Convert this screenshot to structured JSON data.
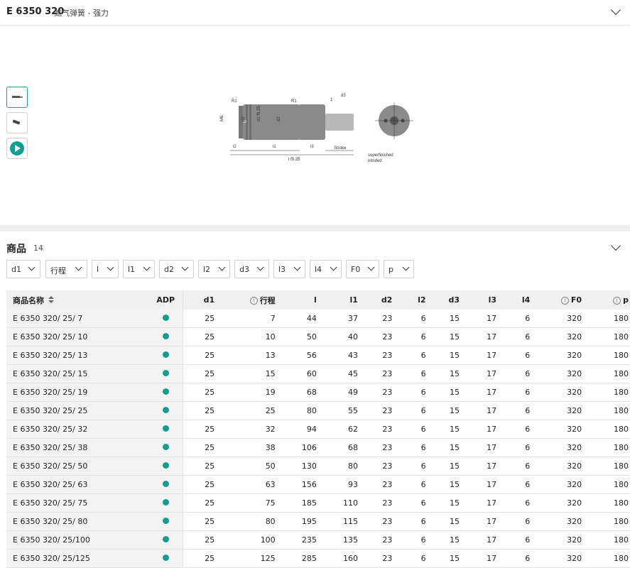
{
  "header": {
    "code": "E 6350 320",
    "subtitle": "氮气弹簧 - 强力"
  },
  "drawing": {
    "labels": [
      "M6",
      "d2",
      "d1 f9.25",
      "d2",
      "R1",
      "R1",
      "1",
      "d3",
      "l2",
      "l1",
      "l3",
      "Stroke",
      "l f9.25",
      "superfinished",
      "nitrided",
      "Φ"
    ]
  },
  "thumbnails": [
    "drawing-thumb",
    "product-photo-thumb",
    "play-video-thumb"
  ],
  "products": {
    "title": "商品",
    "count": "14",
    "filters": [
      "d1",
      "行程",
      "l",
      "l1",
      "d2",
      "l2",
      "d3",
      "l3",
      "l4",
      "F0",
      "p"
    ],
    "columns": [
      "商品名称",
      "ADP",
      "d1",
      "行程",
      "l",
      "l1",
      "d2",
      "l2",
      "d3",
      "l3",
      "l4",
      "F0",
      "p"
    ],
    "rows": [
      [
        "E 6350 320/ 25/ 7",
        "25",
        "7",
        "44",
        "37",
        "23",
        "6",
        "15",
        "17",
        "6",
        "320",
        "180"
      ],
      [
        "E 6350 320/ 25/ 10",
        "25",
        "10",
        "50",
        "40",
        "23",
        "6",
        "15",
        "17",
        "6",
        "320",
        "180"
      ],
      [
        "E 6350 320/ 25/ 13",
        "25",
        "13",
        "56",
        "43",
        "23",
        "6",
        "15",
        "17",
        "6",
        "320",
        "180"
      ],
      [
        "E 6350 320/ 25/ 15",
        "25",
        "15",
        "60",
        "45",
        "23",
        "6",
        "15",
        "17",
        "6",
        "320",
        "180"
      ],
      [
        "E 6350 320/ 25/ 19",
        "25",
        "19",
        "68",
        "49",
        "23",
        "6",
        "15",
        "17",
        "6",
        "320",
        "180"
      ],
      [
        "E 6350 320/ 25/ 25",
        "25",
        "25",
        "80",
        "55",
        "23",
        "6",
        "15",
        "17",
        "6",
        "320",
        "180"
      ],
      [
        "E 6350 320/ 25/ 32",
        "25",
        "32",
        "94",
        "62",
        "23",
        "6",
        "15",
        "17",
        "6",
        "320",
        "180"
      ],
      [
        "E 6350 320/ 25/ 38",
        "25",
        "38",
        "106",
        "68",
        "23",
        "6",
        "15",
        "17",
        "6",
        "320",
        "180"
      ],
      [
        "E 6350 320/ 25/ 50",
        "25",
        "50",
        "130",
        "80",
        "23",
        "6",
        "15",
        "17",
        "6",
        "320",
        "180"
      ],
      [
        "E 6350 320/ 25/ 63",
        "25",
        "63",
        "156",
        "93",
        "23",
        "6",
        "15",
        "17",
        "6",
        "320",
        "180"
      ],
      [
        "E 6350 320/ 25/ 75",
        "25",
        "75",
        "185",
        "110",
        "23",
        "6",
        "15",
        "17",
        "6",
        "320",
        "180"
      ],
      [
        "E 6350 320/ 25/ 80",
        "25",
        "80",
        "195",
        "115",
        "23",
        "6",
        "15",
        "17",
        "6",
        "320",
        "180"
      ],
      [
        "E 6350 320/ 25/100",
        "25",
        "100",
        "235",
        "135",
        "23",
        "6",
        "15",
        "17",
        "6",
        "320",
        "180"
      ],
      [
        "E 6350 320/ 25/125",
        "25",
        "125",
        "285",
        "160",
        "23",
        "6",
        "15",
        "17",
        "6",
        "320",
        "180"
      ]
    ]
  },
  "colors": {
    "accent": "#129e8e",
    "header_bg": "#f0f0f0",
    "band": "#eeeeee"
  }
}
